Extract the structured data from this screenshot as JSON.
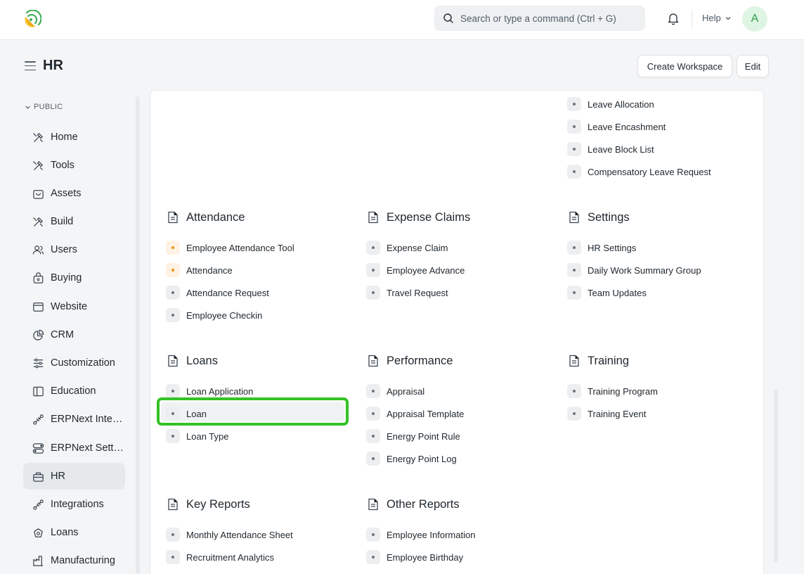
{
  "navbar": {
    "search_placeholder": "Search or type a command (Ctrl + G)",
    "help_label": "Help",
    "avatar_letter": "A"
  },
  "header": {
    "title": "HR",
    "create_workspace_label": "Create Workspace",
    "edit_label": "Edit"
  },
  "sidebar": {
    "group_label": "PUBLIC",
    "items": [
      {
        "label": "Home",
        "icon": "tools-icon"
      },
      {
        "label": "Tools",
        "icon": "tools-icon"
      },
      {
        "label": "Assets",
        "icon": "assets-icon"
      },
      {
        "label": "Build",
        "icon": "tools-icon"
      },
      {
        "label": "Users",
        "icon": "users-icon"
      },
      {
        "label": "Buying",
        "icon": "shopping-bag-icon"
      },
      {
        "label": "Website",
        "icon": "browser-icon"
      },
      {
        "label": "CRM",
        "icon": "pie-chart-icon"
      },
      {
        "label": "Customization",
        "icon": "sliders-icon"
      },
      {
        "label": "Education",
        "icon": "book-icon"
      },
      {
        "label": "ERPNext Integrations",
        "icon": "integration-icon"
      },
      {
        "label": "ERPNext Settings",
        "icon": "toggle-icon"
      },
      {
        "label": "HR",
        "icon": "hr-icon",
        "active": true
      },
      {
        "label": "Integrations",
        "icon": "integration-icon"
      },
      {
        "label": "Loans",
        "icon": "loan-icon"
      },
      {
        "label": "Manufacturing",
        "icon": "factory-icon"
      }
    ]
  },
  "top_links": [
    "Leave Allocation",
    "Leave Encashment",
    "Leave Block List",
    "Compensatory Leave Request"
  ],
  "sections": {
    "attendance": {
      "title": "Attendance",
      "links": [
        "Employee Attendance Tool",
        "Attendance",
        "Attendance Request",
        "Employee Checkin"
      ]
    },
    "expense_claims": {
      "title": "Expense Claims",
      "links": [
        "Expense Claim",
        "Employee Advance",
        "Travel Request"
      ]
    },
    "settings": {
      "title": "Settings",
      "links": [
        "HR Settings",
        "Daily Work Summary Group",
        "Team Updates"
      ]
    },
    "loans": {
      "title": "Loans",
      "links": [
        "Loan Application",
        "Loan",
        "Loan Type"
      ]
    },
    "performance": {
      "title": "Performance",
      "links": [
        "Appraisal",
        "Appraisal Template",
        "Energy Point Rule",
        "Energy Point Log"
      ]
    },
    "training": {
      "title": "Training",
      "links": [
        "Training Program",
        "Training Event"
      ]
    },
    "key_reports": {
      "title": "Key Reports",
      "links": [
        "Monthly Attendance Sheet",
        "Recruitment Analytics"
      ]
    },
    "other_reports": {
      "title": "Other Reports",
      "links": [
        "Employee Information",
        "Employee Birthday"
      ]
    }
  },
  "colors": {
    "highlight": "#34c226",
    "dot_orange": "#e79913"
  }
}
